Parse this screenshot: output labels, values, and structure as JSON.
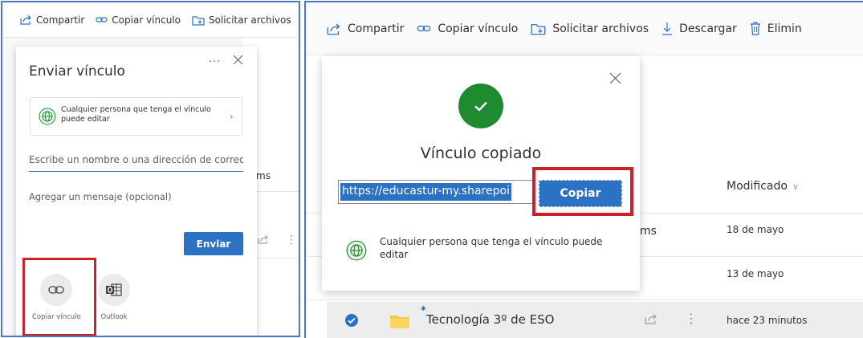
{
  "left": {
    "toolbar": {
      "share_label": "Compartir",
      "copy_link_label": "Copiar vínculo",
      "request_files_label": "Solicitar archivos"
    },
    "background": {
      "row_fragment": "ms"
    },
    "dialog": {
      "title": "Enviar vínculo",
      "more_glyph": "···",
      "permission_text": "Cualquier persona que tenga el vínculo puede editar",
      "name_input_placeholder": "Escribe un nombre o una dirección de correo",
      "message_placeholder": "Agregar un mensaje (opcional)",
      "send_label": "Enviar",
      "options": [
        {
          "label": "Copiar vínculo",
          "icon": "link-icon"
        },
        {
          "label": "Outlook",
          "icon": "outlook-icon"
        }
      ]
    }
  },
  "right": {
    "toolbar": {
      "share_label": "Compartir",
      "copy_link_label": "Copiar vínculo",
      "request_files_label": "Solicitar archivos",
      "download_label": "Descargar",
      "delete_label": "Elimin"
    },
    "list": {
      "modified_header": "Modificado",
      "rows": [
        {
          "name_fragment": "ms",
          "modified": "18 de mayo"
        },
        {
          "name_fragment": "",
          "modified": "13 de mayo"
        },
        {
          "name": "Tecnología 3º de ESO",
          "modified": "hace 23 minutos",
          "selected": true
        }
      ]
    },
    "dialog": {
      "title": "Vínculo copiado",
      "url_text": "https://educastur-my.sharepoi",
      "copy_label": "Copiar",
      "permission_text": "Cualquier persona que tenga el vínculo puede editar"
    }
  },
  "colors": {
    "accent": "#2b71c4",
    "success": "#1f8a2f",
    "highlight_box": "#c9232a",
    "panel_border": "#4a78c2"
  }
}
